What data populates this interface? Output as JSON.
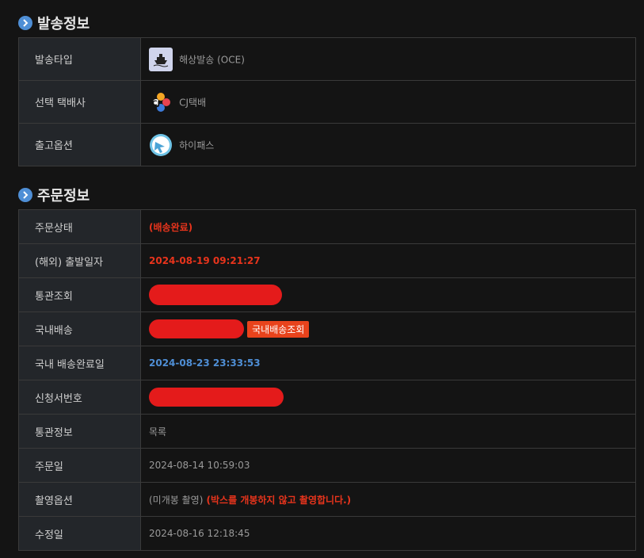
{
  "shipping_section": {
    "title": "발송정보",
    "rows": [
      {
        "label": "발송타입",
        "value": "해상발송 (OCE)",
        "icon": "ship-icon"
      },
      {
        "label": "선택 택배사",
        "value": "CJ택배",
        "icon": "cj-logo-icon"
      },
      {
        "label": "출고옵션",
        "value": "하이패스",
        "icon": "hipass-icon"
      }
    ]
  },
  "order_section": {
    "title": "주문정보",
    "status_label": "주문상태",
    "status_value": "(배송완료)",
    "departure_label": "(해외) 출발일자",
    "departure_value": "2024-08-19 09:21:27",
    "customs_lookup_label": "통관조회",
    "domestic_shipping_label": "국내배송",
    "domestic_tracking_button": "국내배송조회",
    "domestic_done_label": "국내 배송완료일",
    "domestic_done_value": "2024-08-23 23:33:53",
    "application_no_label": "신청서번호",
    "customs_info_label": "통관정보",
    "customs_info_value": "목록",
    "order_date_label": "주문일",
    "order_date_value": "2024-08-14 10:59:03",
    "photo_option_label": "촬영옵션",
    "photo_option_value": "(미개봉 촬영)",
    "photo_option_note": "(박스를 개봉하지 않고 촬영합니다.)",
    "modified_date_label": "수정일",
    "modified_date_value": "2024-08-16 12:18:45"
  },
  "colors": {
    "accent_blue": "#4f8fd6",
    "status_red": "#e8341c",
    "redaction": "#e41b1b",
    "button_orange": "#e8431c"
  }
}
